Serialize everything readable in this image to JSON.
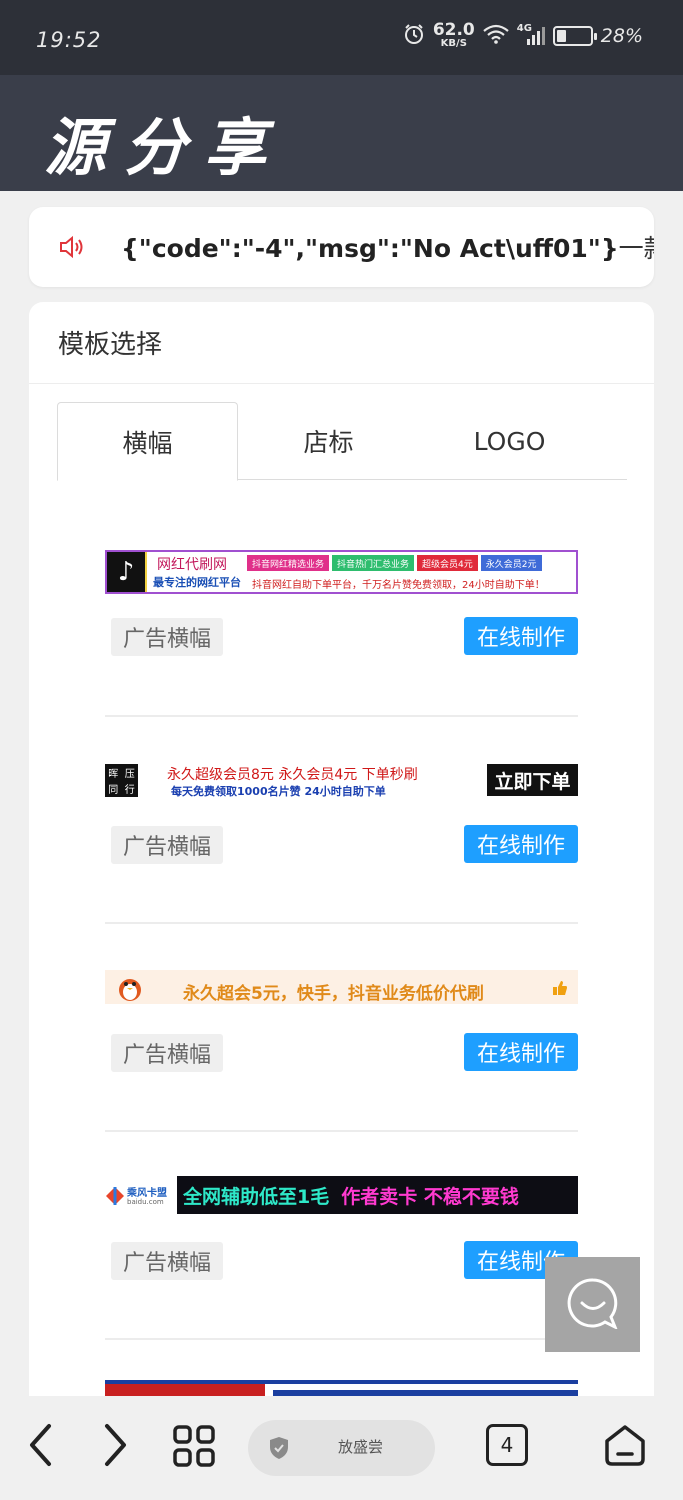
{
  "status_bar": {
    "time": "19:52",
    "speed_value": "62.0",
    "speed_unit": "KB/S",
    "network_type": "4G",
    "battery_percent": "28%",
    "battery_level": 0.28,
    "icons": [
      "alarm-icon",
      "wifi-icon",
      "cellular-signal-icon",
      "battery-icon"
    ]
  },
  "header": {
    "logo_text": "源分享"
  },
  "notice": {
    "icon": "speaker-icon",
    "strong_text": "{\"code\":\"-4\",\"msg\":\"No Act\\uff01\"}",
    "text": "一款免费精"
  },
  "template_card": {
    "title": "模板选择",
    "tabs": [
      {
        "label": "横幅",
        "active": true
      },
      {
        "label": "店标",
        "active": false
      },
      {
        "label": "LOGO",
        "active": false
      }
    ],
    "items": [
      {
        "tag": "广告横幅",
        "button": "在线制作",
        "banner": {
          "title": "网红代刷网",
          "subtitle": "最专注的网红平台",
          "chips": [
            "抖音网红精选业务",
            "抖音热门汇总业务",
            "超级会员4元",
            "永久会员2元"
          ],
          "description": "抖音网红自助下单平台，千万名片赞免费领取，24小时自助下单！"
        }
      },
      {
        "tag": "广告横幅",
        "button": "在线制作",
        "banner": {
          "left_chars": [
            "晖",
            "压",
            "同",
            "行"
          ],
          "line1": "永久超级会员8元  永久会员4元  下单秒刷",
          "line2": "每天免费领取1000名片赞  24小时自助下单",
          "right_label": "立即下单"
        }
      },
      {
        "tag": "广告横幅",
        "button": "在线制作",
        "banner": {
          "text": "永久超会5元，快手，抖音业务低价代刷",
          "icon": "thumbs-up-icon"
        }
      },
      {
        "tag": "广告横幅",
        "button": "在线制作",
        "banner": {
          "brand": "乘风卡盟",
          "brand_sub": "baidu.com",
          "green_text": "全网辅助低至1毛",
          "magenta_text": "作者卖卡 不稳不要钱"
        }
      }
    ]
  },
  "floating_button": {
    "icon": "chat-bubble-icon"
  },
  "bottom_nav": {
    "url_text": "放盛尝",
    "tab_count": "4",
    "icons": [
      "back-arrow-icon",
      "forward-arrow-icon",
      "grid-menu-icon",
      "shield-icon",
      "home-icon"
    ]
  },
  "colors": {
    "status_bg": "#2d3038",
    "header_bg": "#3a3e4a",
    "accent_button": "#1e9fff",
    "page_bg": "#f0f0f0"
  }
}
